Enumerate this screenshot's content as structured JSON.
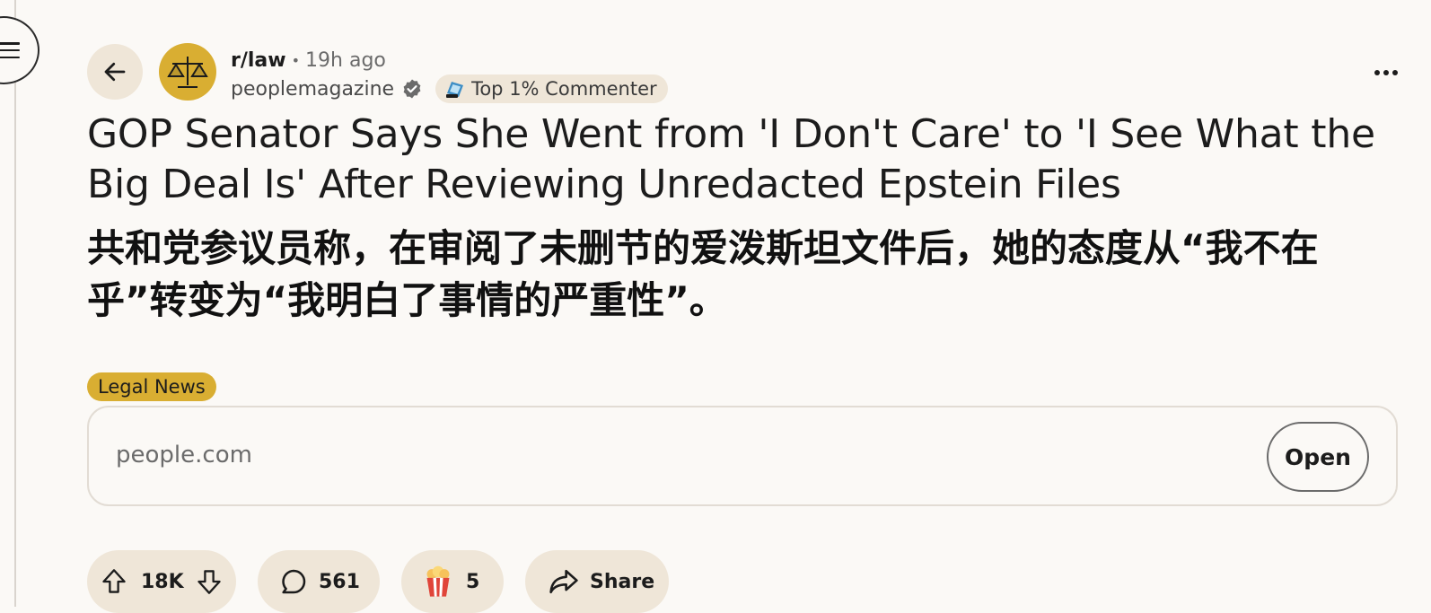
{
  "post": {
    "subreddit": "r/law",
    "separator": "•",
    "time": "19h ago",
    "author": "peoplemagazine",
    "badge": "Top 1% Commenter",
    "title_en": "GOP Senator Says She Went from 'I Don't Care' to 'I See What the Big Deal Is' After Reviewing Unredacted Epstein Files",
    "title_zh": "共和党参议员称，在审阅了未删节的爱泼斯坦文件后，她的态度从“我不在乎”转变为“我明白了事情的严重性”。",
    "flair": "Legal News",
    "flair_color": "#d9ae32"
  },
  "link_card": {
    "domain": "people.com",
    "open_label": "Open"
  },
  "actions": {
    "upvotes": "18K",
    "comments": "561",
    "awards": "5",
    "share_label": "Share"
  },
  "icons": {
    "menu": "hamburger-icon",
    "back": "arrow-left-icon",
    "avatar": "scales-of-justice-icon",
    "verified": "verified-check-icon",
    "badge": "achievement-icon",
    "more": "more-horizontal-icon",
    "upvote": "upvote-arrow-icon",
    "downvote": "downvote-arrow-icon",
    "comment": "comment-bubble-icon",
    "award": "popcorn-icon",
    "share": "share-arrow-icon"
  },
  "colors": {
    "background": "#fbf9f6",
    "pill": "#efe6d8",
    "accent": "#d9ae32"
  }
}
